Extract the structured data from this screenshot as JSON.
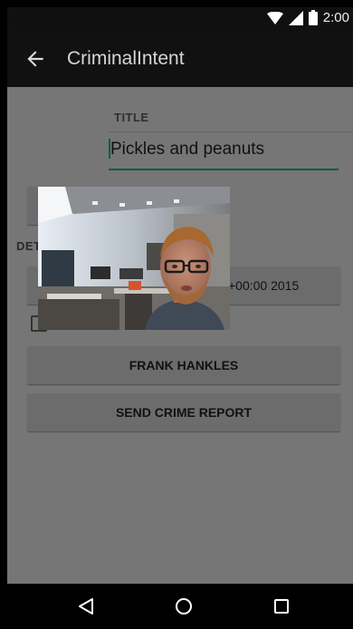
{
  "status_bar": {
    "time": "2:00"
  },
  "toolbar": {
    "title": "CriminalIntent"
  },
  "form": {
    "title_label": "TITLE",
    "title_value": "Pickles and peanuts",
    "details_label": "DET",
    "date_text": "+00:00 2015",
    "suspect_button": "FRANK HANKLES",
    "report_button": "SEND CRIME REPORT"
  },
  "icons": {
    "back": "arrow-left-icon",
    "wifi": "wifi-icon",
    "signal": "signal-icon",
    "battery": "battery-icon",
    "nav_back": "triangle-back-icon",
    "nav_home": "circle-home-icon",
    "nav_recents": "square-recents-icon"
  }
}
